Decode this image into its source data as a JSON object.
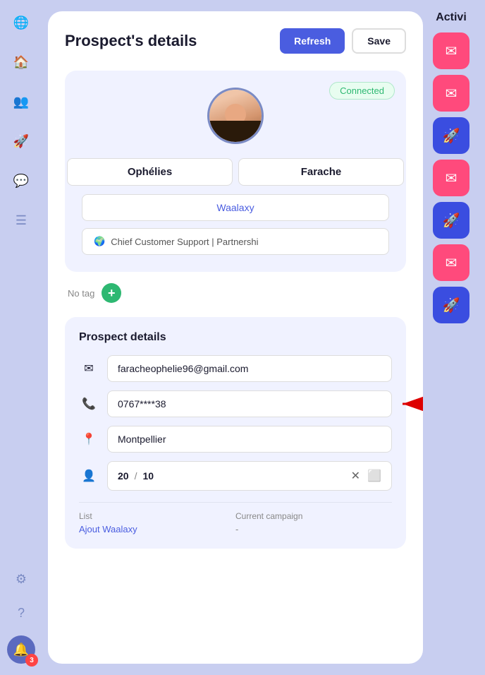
{
  "sidebar": {
    "icons": [
      {
        "name": "globe-icon",
        "symbol": "🌐"
      },
      {
        "name": "home-icon",
        "symbol": "🏠"
      },
      {
        "name": "users-icon",
        "symbol": "👥"
      },
      {
        "name": "rocket-icon",
        "symbol": "🚀"
      },
      {
        "name": "chat-icon",
        "symbol": "💬"
      },
      {
        "name": "list-icon",
        "symbol": "☰"
      },
      {
        "name": "settings-icon",
        "symbol": "⚙"
      },
      {
        "name": "help-icon",
        "symbol": "?"
      }
    ],
    "notification_count": "3"
  },
  "header": {
    "title": "Prospect's details",
    "refresh_label": "Refresh",
    "save_label": "Save"
  },
  "profile": {
    "connected_badge": "Connected",
    "first_name": "Ophélies",
    "last_name": "Farache",
    "company": "Waalaxy",
    "role_emoji": "🌍",
    "role": "Chief Customer Support | Partnershi"
  },
  "tags": {
    "no_tag_label": "No tag"
  },
  "prospect_details": {
    "section_title": "Prospect details",
    "email": "faracheophelie96@gmail.com",
    "phone": "0767****38",
    "location": "Montpellier",
    "score_current": "20",
    "score_divider": "/",
    "score_max": "10",
    "list_label": "List",
    "list_value": "Ajout Waalaxy",
    "campaign_label": "Current campaign",
    "campaign_value": "-"
  },
  "activity": {
    "title": "Activi"
  }
}
